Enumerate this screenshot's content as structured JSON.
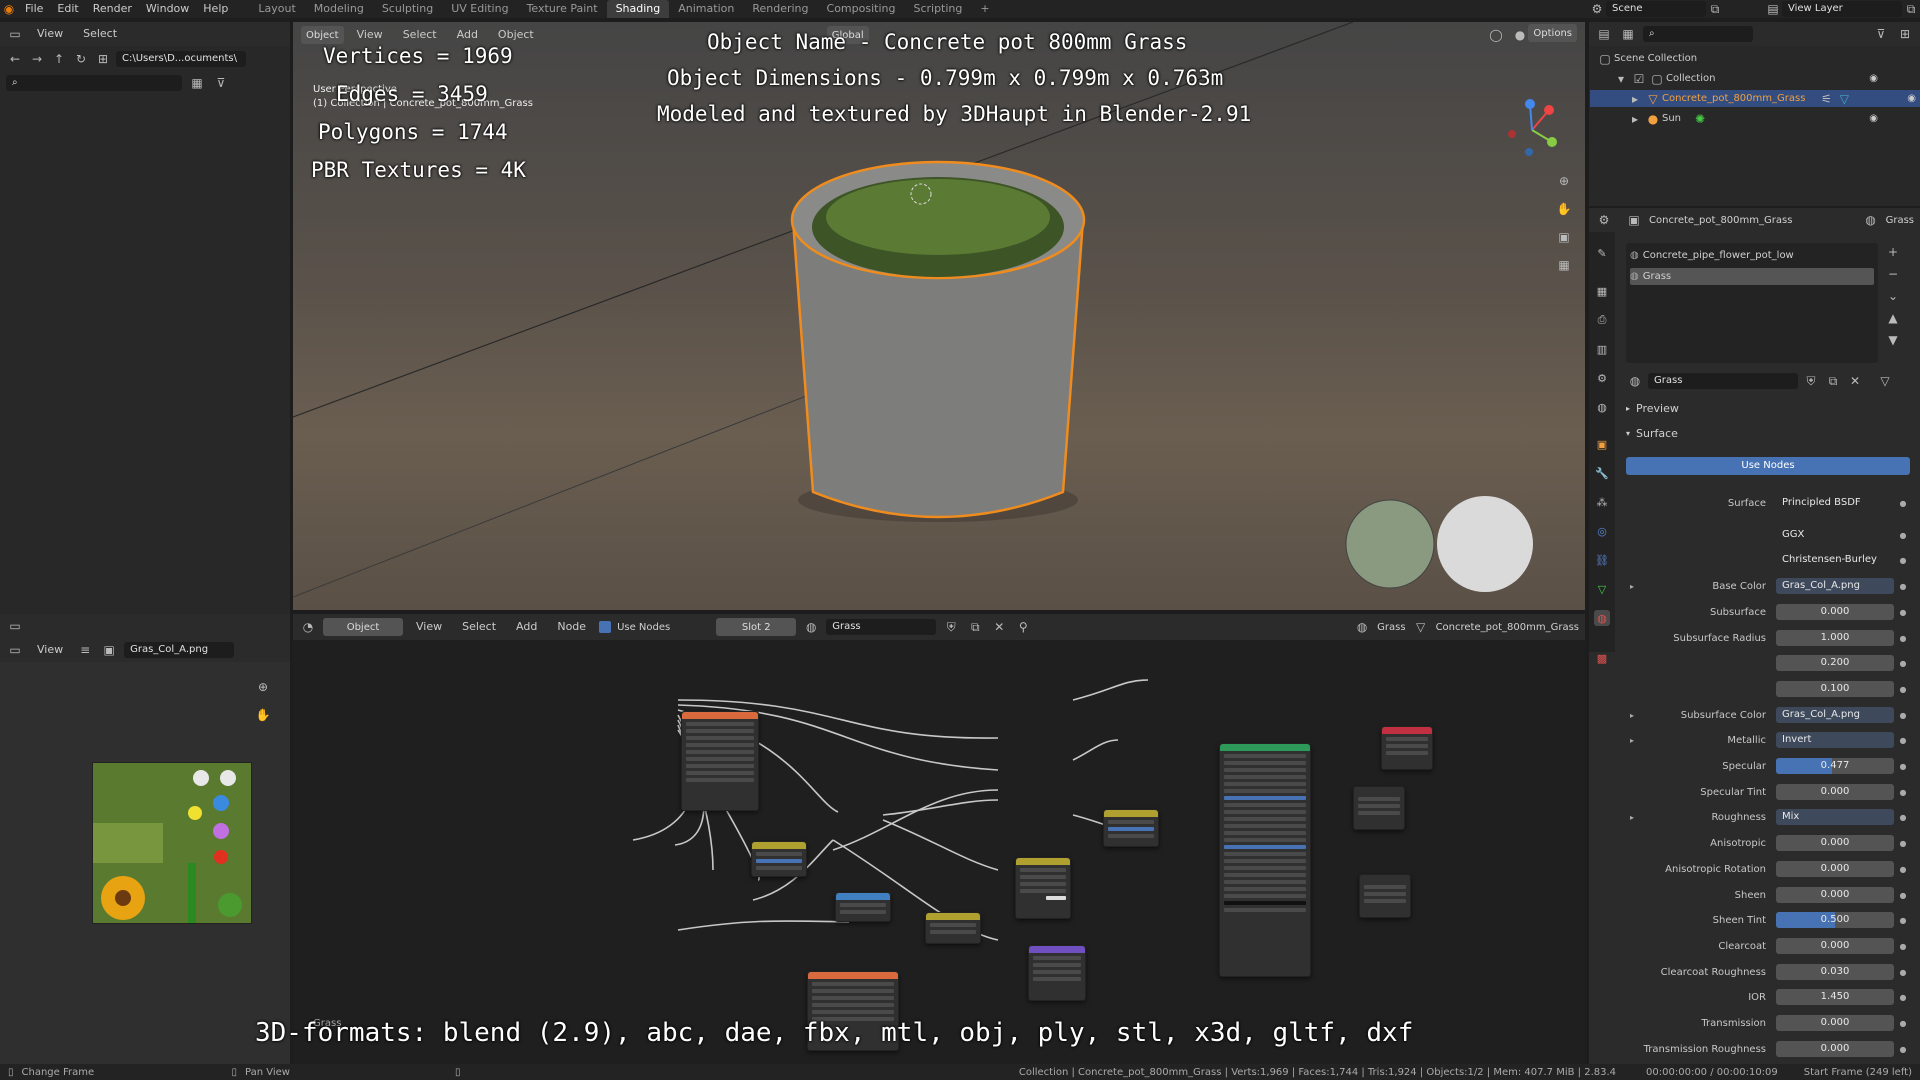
{
  "topbar": {
    "menus": [
      "File",
      "Edit",
      "Render",
      "Window",
      "Help"
    ],
    "workspaces": [
      "Layout",
      "Modeling",
      "Sculpting",
      "UV Editing",
      "Texture Paint",
      "Shading",
      "Animation",
      "Rendering",
      "Compositing",
      "Scripting"
    ],
    "active_workspace": "Shading",
    "scene_label": "Scene",
    "view_layer_label": "View Layer"
  },
  "file_browser": {
    "menus": [
      "View",
      "Select"
    ],
    "path": "C:\\Users\\D...ocuments\\"
  },
  "viewport": {
    "header_items": [
      "Object",
      "View",
      "Select",
      "Add",
      "Object"
    ],
    "orientation": "Global",
    "options_label": "Options",
    "mode_label": "User Perspective",
    "collection_info": "(1) Collection | Concrete_pot_800mm_Grass",
    "overlay": {
      "object_name": "Object Name - Concrete pot 800mm Grass",
      "dimensions": "Object Dimensions -  0.799m x 0.799m x 0.763m",
      "credits": "Modeled and textured by 3DHaupt in Blender-2.91",
      "vertices": "Vertices = 1969",
      "edges": "Edges = 3459",
      "polygons": "Polygons = 1744",
      "textures": "PBR Textures = 4K",
      "formats": "3D-formats: blend (2.9), abc, dae, fbx, mtl, obj, ply, stl, x3d, gltf, dxf"
    }
  },
  "image_editor": {
    "view_label": "View",
    "image_name": "Gras_Col_A.png"
  },
  "node_editor": {
    "mode": "Object",
    "menus": [
      "View",
      "Select",
      "Add",
      "Node"
    ],
    "use_nodes_label": "Use Nodes",
    "slot": "Slot 2",
    "material": "Grass",
    "material_right": "Grass",
    "object_name": "Concrete_pot_800mm_Grass",
    "frame_label": "Grass"
  },
  "outliner": {
    "scene_collection": "Scene Collection",
    "collection": "Collection",
    "items": [
      "Concrete_pot_800mm_Grass",
      "Sun"
    ]
  },
  "properties": {
    "object_name": "Concrete_pot_800mm_Grass",
    "material_tab": "Grass",
    "slots": [
      "Concrete_pipe_flower_pot_low",
      "Grass"
    ],
    "material_name": "Grass",
    "preview_label": "Preview",
    "surface_label": "Surface",
    "use_nodes_button": "Use Nodes",
    "rows": [
      {
        "label": "Surface",
        "value": "Principled BSDF",
        "kind": "text"
      },
      {
        "label": "",
        "value": "GGX",
        "kind": "dropdown"
      },
      {
        "label": "",
        "value": "Christensen-Burley",
        "kind": "dropdown"
      },
      {
        "label": "Base Color",
        "value": "Gras_Col_A.png",
        "kind": "link"
      },
      {
        "label": "Subsurface",
        "value": "0.000",
        "kind": "num"
      },
      {
        "label": "Subsurface Radius",
        "value": "1.000",
        "kind": "num"
      },
      {
        "label": "",
        "value": "0.200",
        "kind": "num"
      },
      {
        "label": "",
        "value": "0.100",
        "kind": "num"
      },
      {
        "label": "Subsurface Color",
        "value": "Gras_Col_A.png",
        "kind": "link"
      },
      {
        "label": "Metallic",
        "value": "Invert",
        "kind": "link"
      },
      {
        "label": "Specular",
        "value": "0.477",
        "kind": "num",
        "fill": 0.477
      },
      {
        "label": "Specular Tint",
        "value": "0.000",
        "kind": "num"
      },
      {
        "label": "Roughness",
        "value": "Mix",
        "kind": "link"
      },
      {
        "label": "Anisotropic",
        "value": "0.000",
        "kind": "num"
      },
      {
        "label": "Anisotropic Rotation",
        "value": "0.000",
        "kind": "num"
      },
      {
        "label": "Sheen",
        "value": "0.000",
        "kind": "num"
      },
      {
        "label": "Sheen Tint",
        "value": "0.500",
        "kind": "num",
        "fill": 0.5
      },
      {
        "label": "Clearcoat",
        "value": "0.000",
        "kind": "num"
      },
      {
        "label": "Clearcoat Roughness",
        "value": "0.030",
        "kind": "num"
      },
      {
        "label": "IOR",
        "value": "1.450",
        "kind": "num"
      },
      {
        "label": "Transmission",
        "value": "0.000",
        "kind": "num"
      },
      {
        "label": "Transmission Roughness",
        "value": "0.000",
        "kind": "num"
      }
    ]
  },
  "statusbar": {
    "left": "Change Frame",
    "middle": "Pan View",
    "stats": "Collection | Concrete_pot_800mm_Grass | Verts:1,969 | Faces:1,744 | Tris:1,924 | Objects:1/2 | Mem: 407.7 MiB | 2.83.4",
    "time": "00:00:00:00 / 00:00:10:09",
    "frame": "Start Frame (249 left)"
  }
}
